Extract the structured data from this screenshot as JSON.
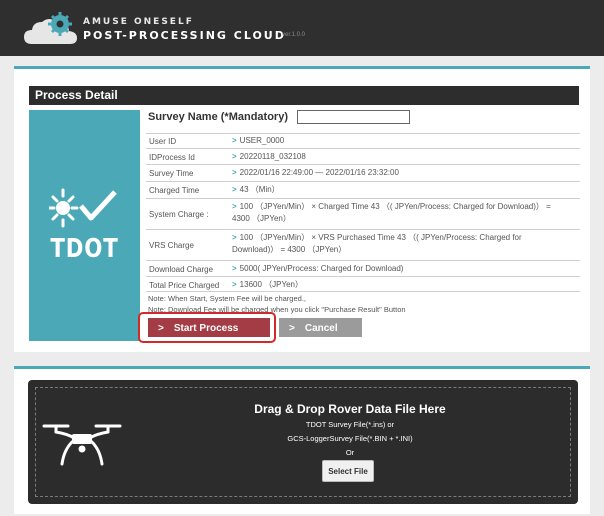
{
  "header": {
    "brand_top": "AMUSE ONESELF",
    "brand_main": "POST-PROCESSING CLOUD",
    "version": "ver.1.0.0",
    "logo_icon": "cloud-gear-icon"
  },
  "colors": {
    "header_bg": "#2f2f2f",
    "accent_teal": "#4ba9b7",
    "start_button": "#a33c45",
    "cancel_button": "#9b9b9b",
    "highlight": "#d22a2a"
  },
  "process_detail": {
    "title": "Process Detail",
    "logo_text": "TDOT",
    "survey_name_label": "Survey Name (*Mandatory)",
    "survey_name_value": "",
    "rows": [
      {
        "label": "User ID",
        "value": "USER_0000"
      },
      {
        "label": "IDProcess Id",
        "value": "20220118_032108"
      },
      {
        "label": "Survey Time",
        "value": "2022/01/16 22:49:00 — 2022/01/16 23:32:00"
      },
      {
        "label": "Charged Time",
        "value": "43 （Min）"
      },
      {
        "label": "System Charge :",
        "value": "100 （JPYen/Min） × Charged Time 43 （( JPYen/Process: Charged for Download)） = 4300 （JPYen）"
      },
      {
        "label": "VRS Charge",
        "value": "100 （JPYen/Min） × VRS Purchased Time 43 （( JPYen/Process: Charged for Download)） = 4300 （JPYen）"
      },
      {
        "label": "Download Charge",
        "value": "5000( JPYen/Process: Charged for Download)"
      },
      {
        "label": "Total Price Charged",
        "value": "13600 （JPYen）"
      }
    ],
    "note_1": "Note: When Start, System Fee will be charged.,",
    "note_2": "Note: Download Fee will be charged when you click \"Purchase Result\" Button",
    "start_label": "Start Process",
    "cancel_label": "Cancel"
  },
  "upload": {
    "title": "Drag & Drop Rover Data File Here",
    "line1": "TDOT Survey File(*.ins)  or",
    "line2": "GCS-LoggerSurvey File(*.BIN + *.INI)",
    "line3": "Or",
    "select_label": "Select File",
    "icon": "drone-icon"
  }
}
